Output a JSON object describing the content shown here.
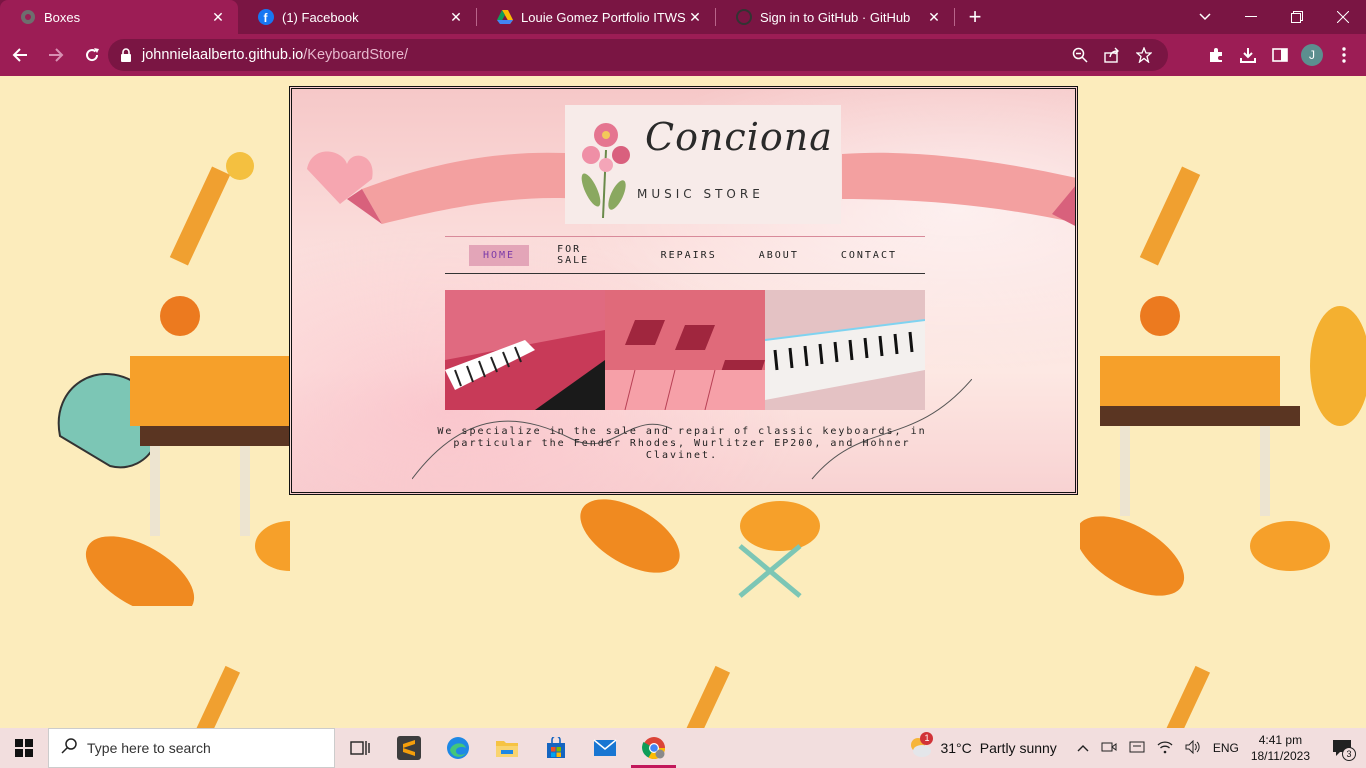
{
  "browser": {
    "tabs": [
      {
        "title": "Boxes",
        "icon": "globe-icon",
        "active": true
      },
      {
        "title": "(1) Facebook",
        "icon": "facebook-icon",
        "active": false
      },
      {
        "title": "Louie Gomez Portfolio ITWS.zip",
        "icon": "google-drive-icon",
        "active": false
      },
      {
        "title": "Sign in to GitHub · GitHub",
        "icon": "github-icon",
        "active": false
      }
    ],
    "close_glyph": "✕",
    "new_tab_glyph": "+",
    "url_host": "johnnielaalberto.github.io",
    "url_path": "/KeyboardStore/",
    "profile_initial": "J"
  },
  "site": {
    "logo_script": "Conciona",
    "logo_sub": "MUSIC STORE",
    "nav": [
      {
        "label": "HOME",
        "active": true
      },
      {
        "label": "FOR SALE",
        "active": false
      },
      {
        "label": "REPAIRS",
        "active": false
      },
      {
        "label": "ABOUT",
        "active": false
      },
      {
        "label": "CONTACT",
        "active": false
      }
    ],
    "tagline": "We specialize in the sale and repair of classic keyboards, in particular the Fender Rhodes, Wurlitzer EP200, and Hohner Clavinet."
  },
  "taskbar": {
    "search_placeholder": "Type here to search",
    "weather_temp": "31°C",
    "weather_text": "Partly sunny",
    "weather_badge": "1",
    "lang": "ENG",
    "time": "4:41 pm",
    "date": "18/11/2023",
    "notification_count": "3"
  },
  "colors": {
    "tabbar": "#7a1543",
    "toolbar": "#9c1d55",
    "page_bg": "#fcecbc",
    "nav_active": "#e3a5b8"
  }
}
